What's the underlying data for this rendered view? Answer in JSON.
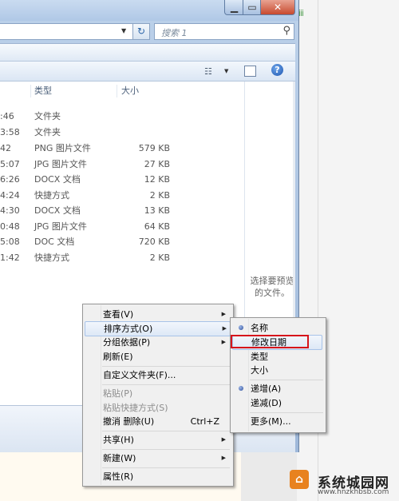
{
  "search": {
    "placeholder": "搜索 1"
  },
  "list": {
    "headers": {
      "type": "类型",
      "size": "大小"
    },
    "rows": [
      {
        "time": ":46",
        "type": "文件夹",
        "size": ""
      },
      {
        "time": "3:58",
        "type": "文件夹",
        "size": ""
      },
      {
        "time": "42",
        "type": "PNG 图片文件",
        "size": "579 KB"
      },
      {
        "time": "5:07",
        "type": "JPG 图片文件",
        "size": "27 KB"
      },
      {
        "time": "6:26",
        "type": "DOCX 文档",
        "size": "12 KB"
      },
      {
        "time": "4:24",
        "type": "快捷方式",
        "size": "2 KB"
      },
      {
        "time": "4:30",
        "type": "DOCX 文档",
        "size": "13 KB"
      },
      {
        "time": "0:48",
        "type": "JPG 图片文件",
        "size": "64 KB"
      },
      {
        "time": "5:08",
        "type": "DOC 文档",
        "size": "720 KB"
      },
      {
        "time": "1:42",
        "type": "快捷方式",
        "size": "2 KB"
      }
    ]
  },
  "preview": {
    "text": "选择要预览的文件。"
  },
  "context_menu": {
    "view": "查看(V)",
    "sort": "排序方式(O)",
    "group": "分组依据(P)",
    "refresh": "刷新(E)",
    "customize": "自定义文件夹(F)...",
    "paste": "粘贴(P)",
    "paste_shortcut": "粘贴快捷方式(S)",
    "undo": "撤消 删除(U)",
    "undo_shortcut": "Ctrl+Z",
    "share": "共享(H)",
    "new": "新建(W)",
    "properties": "属性(R)"
  },
  "sort_submenu": {
    "name": "名称",
    "date_modified": "修改日期",
    "type": "类型",
    "size": "大小",
    "ascending": "递增(A)",
    "descending": "递减(D)",
    "more": "更多(M)..."
  },
  "watermark": {
    "title": "系统城园网",
    "url": "www.hnzkhbsb.com"
  },
  "colors": {
    "highlight_border": "#d6141b",
    "window_frame": "#b0c8e6"
  },
  "icons": [
    "minimize-icon",
    "maximize-icon",
    "close-icon",
    "refresh-icon",
    "search-icon",
    "views-icon",
    "preview-pane-icon",
    "help-icon",
    "radio-bullet-icon",
    "submenu-arrow-icon"
  ]
}
